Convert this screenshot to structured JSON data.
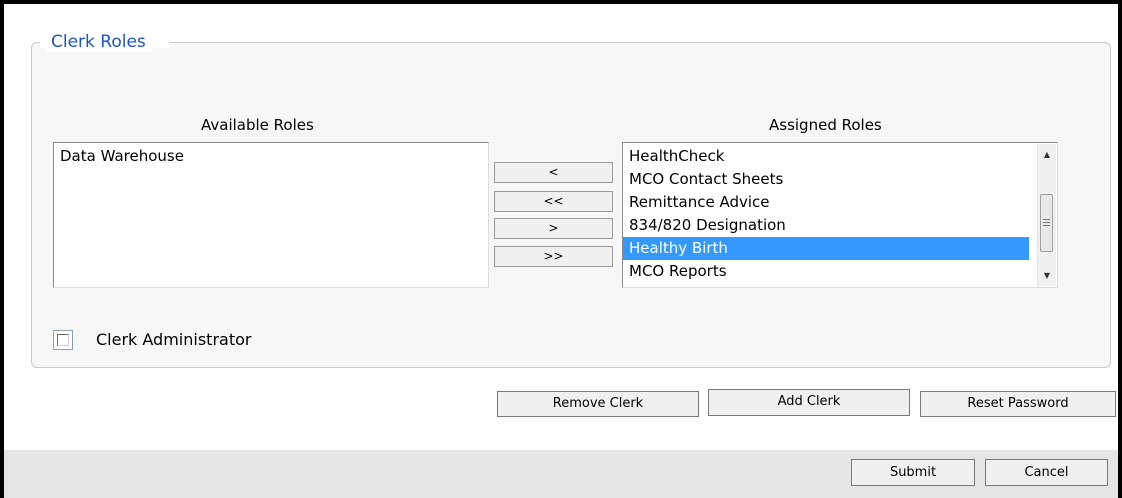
{
  "fieldset": {
    "legend": "Clerk Roles"
  },
  "available": {
    "title": "Available Roles",
    "items": [
      "Data Warehouse"
    ]
  },
  "assigned": {
    "title": "Assigned Roles",
    "items": [
      "HealthCheck",
      "MCO Contact Sheets",
      "Remittance Advice",
      "834/820 Designation",
      "Healthy Birth",
      "MCO Reports"
    ],
    "selected": "Healthy Birth"
  },
  "move_buttons": {
    "remove_one": "<",
    "remove_all": "<<",
    "add_one": ">",
    "add_all": ">>"
  },
  "clerk_admin": {
    "label": "Clerk Administrator",
    "checked": false
  },
  "actions": {
    "remove_clerk": "Remove Clerk",
    "add_clerk": "Add Clerk",
    "reset_password": "Reset Password"
  },
  "footer": {
    "submit": "Submit",
    "cancel": "Cancel"
  },
  "colors": {
    "legend": "#1a56c8",
    "selection": "#3399ff"
  }
}
